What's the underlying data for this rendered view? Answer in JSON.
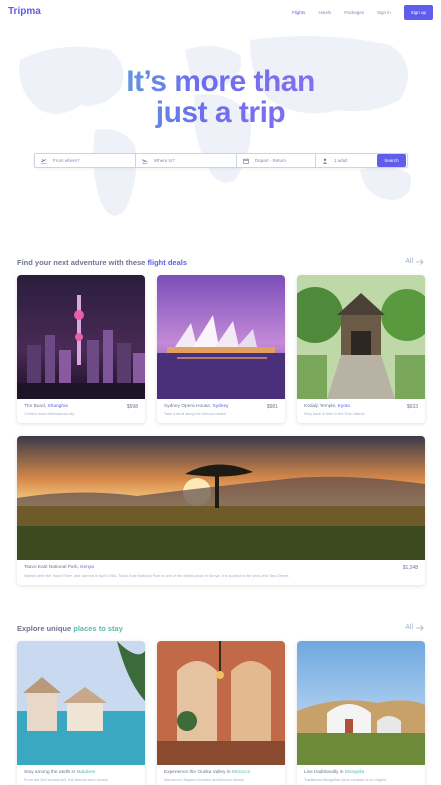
{
  "brand": {
    "logo": "Tripma",
    "accent": "#605dec",
    "teal": "#54bbaa"
  },
  "nav": {
    "flights": "Flights",
    "hotels": "Hotels",
    "packages": "Packages",
    "signin": "Sign in",
    "signup": "Sign up"
  },
  "hero": {
    "line1": "It’s more than",
    "line2": "just a trip"
  },
  "search": {
    "from_placeholder": "From where?",
    "to_placeholder": "Where to?",
    "dates_placeholder": "Depart - Return",
    "travelers": "1 adult",
    "button": "Search"
  },
  "flight_section": {
    "title_prefix": "Find your next adventure with these ",
    "title_highlight": "flight deals",
    "all": "All",
    "cards": [
      {
        "place": "The Bund, ",
        "city": "Shanghai",
        "price": "$598",
        "desc": "China's most international city"
      },
      {
        "place": "Sydney Opera House, ",
        "city": "Sydney",
        "price": "$981",
        "desc": "Take a stroll along the famous harbor"
      },
      {
        "place": "Kōdaiji Temple, ",
        "city": "Kyoto",
        "price": "$633",
        "desc": "Step back in time in the Gion district"
      },
      {
        "place": "Tsavo East National Park, ",
        "city": "Kenya",
        "price": "$1,248",
        "desc": "Named after the Tsavo River, and opened in April 1984, Tsavo East National Park is one of the oldest parks in Kenya. It is located in the semi-arid Taru Desert."
      }
    ]
  },
  "stay_section": {
    "title_prefix": "Explore unique ",
    "title_highlight": "places to stay",
    "all": "All",
    "cards": [
      {
        "place": "Stay among the atolls in ",
        "city": "Maldives",
        "desc": "From the 2nd century AD, the islands were known"
      },
      {
        "place": "Experience the Ourika Valley in ",
        "city": "Morocco",
        "desc": "Morocco's Hispano-Moorish architecture blends"
      },
      {
        "place": "Live traditionally in ",
        "city": "Mongolia",
        "desc": "Traditional Mongolian yurts consists of an angled"
      }
    ]
  }
}
